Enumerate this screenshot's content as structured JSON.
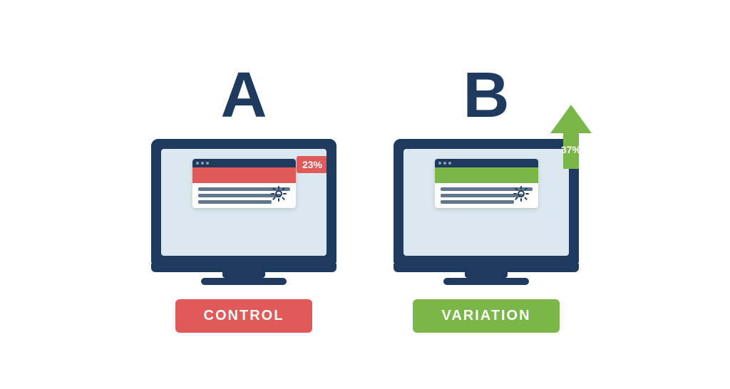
{
  "variantA": {
    "letter": "A",
    "percentageLabel": "23%",
    "labelText": "CONTROL",
    "headerColor": "red",
    "badgeColor": "red"
  },
  "variantB": {
    "letter": "B",
    "percentageLabel": "37%",
    "labelText": "VARIATION",
    "headerColor": "green",
    "badgeColor": "green"
  }
}
